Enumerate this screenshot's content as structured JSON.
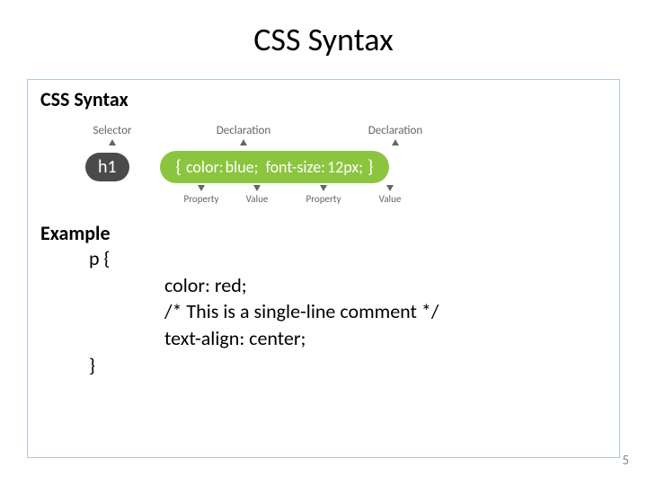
{
  "title": "CSS Syntax",
  "section_heading": "CSS Syntax",
  "diagram": {
    "label_selector": "Selector",
    "label_declaration": "Declaration",
    "selector_text": "h1",
    "brace_open": "{",
    "prop1": "color:",
    "val1": "blue;",
    "prop2": "font-size:",
    "val2": "12px;",
    "brace_close": "}",
    "label_property": "Property",
    "label_value": "Value"
  },
  "example": {
    "heading": "Example",
    "line1": "p {",
    "line2": "color: red;",
    "line3": "/* This is a single-line comment */",
    "line4": "text-align: center;",
    "line5": "}"
  },
  "page_number": "5"
}
